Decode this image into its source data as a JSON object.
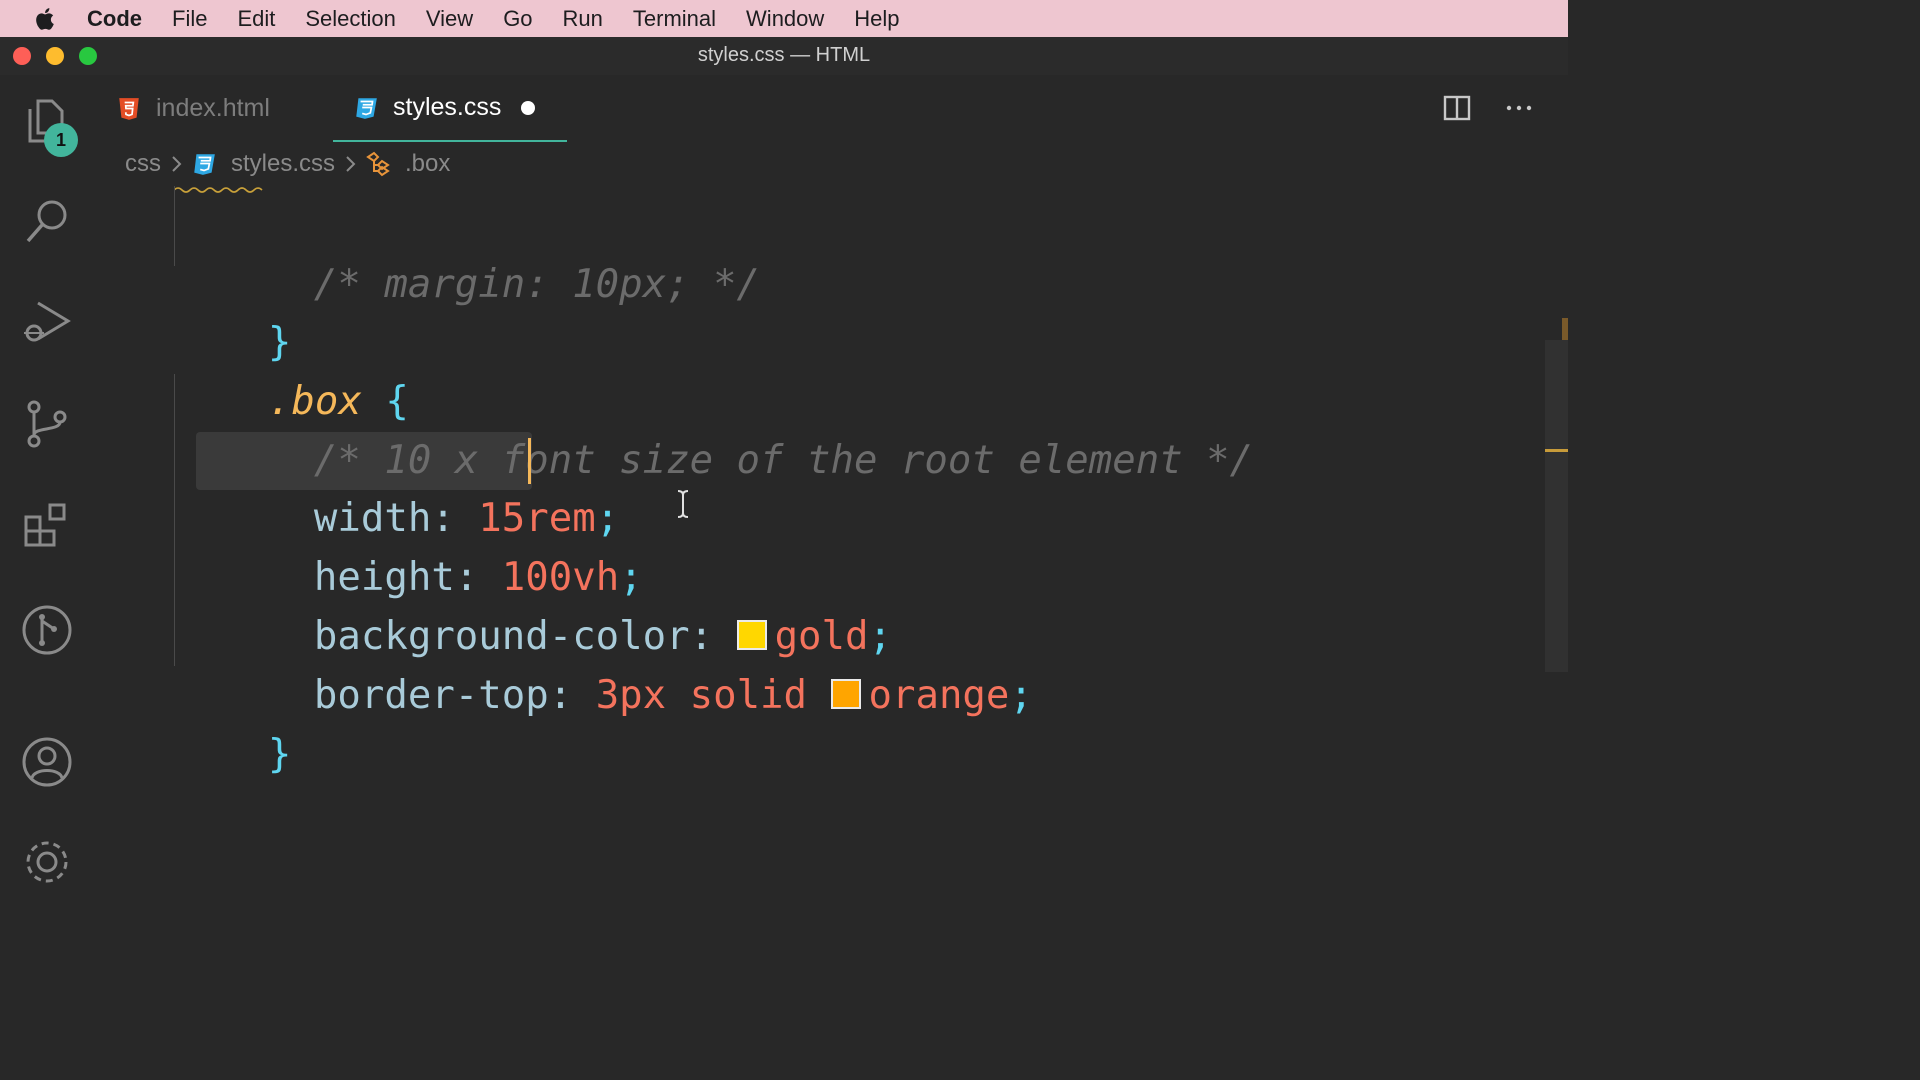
{
  "menubar": {
    "app": "Code",
    "items": [
      "File",
      "Edit",
      "Selection",
      "View",
      "Go",
      "Run",
      "Terminal",
      "Window",
      "Help"
    ]
  },
  "window": {
    "title": "styles.css — HTML"
  },
  "activity": {
    "explorer_badge": "1"
  },
  "tabs": [
    {
      "label": "index.html",
      "icon": "html5-icon",
      "active": false
    },
    {
      "label": "styles.css",
      "icon": "css3-icon",
      "active": true,
      "dirty": true
    }
  ],
  "breadcrumb": {
    "folder": "css",
    "file": "styles.css",
    "symbol": ".box"
  },
  "code": {
    "l1_comment": "/* margin: 10px; */",
    "l2_brace": "}",
    "l3_selector": ".box",
    "l3_brace": "{",
    "l4_comment": "/* 10 x font size of the root element */",
    "l5_prop": "width:",
    "l5_val": "15rem",
    "l5_semi": ";",
    "l6_prop": "height:",
    "l6_val": "100vh",
    "l6_semi": ";",
    "l7_prop": "background-color:",
    "l7_val": "gold",
    "l7_semi": ";",
    "l8_prop": "border-top:",
    "l8_val1": "3px solid",
    "l8_val2": "orange",
    "l8_semi": ";",
    "l9_brace": "}"
  },
  "colors": {
    "gold_swatch": "#ffd700",
    "orange_swatch": "#ffa500",
    "accent": "#42b59c"
  }
}
